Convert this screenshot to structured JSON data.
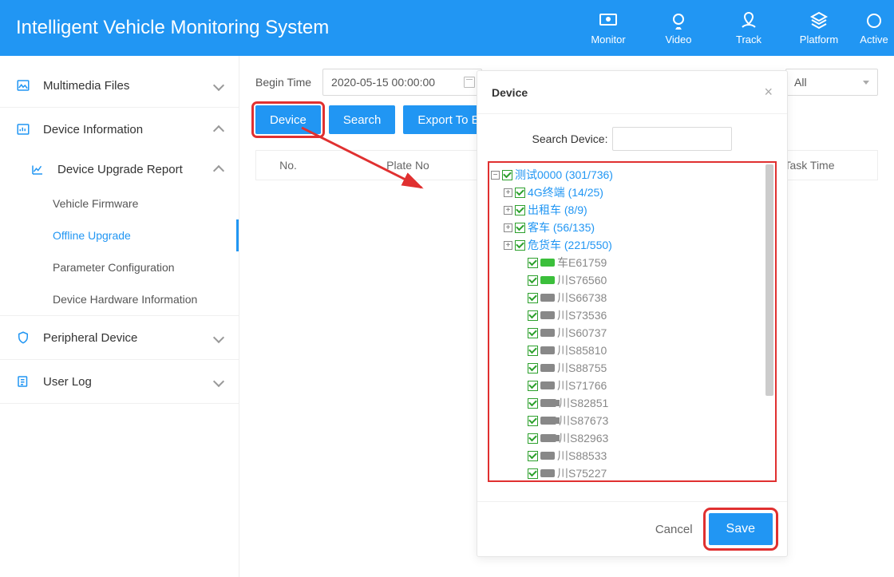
{
  "header": {
    "title": "Intelligent Vehicle Monitoring System",
    "nav": {
      "monitor": "Monitor",
      "video": "Video",
      "track": "Track",
      "platform": "Platform",
      "active": "Active"
    }
  },
  "sidebar": {
    "multimedia": "Multimedia Files",
    "device_info": "Device Information",
    "upgrade_report": "Device Upgrade Report",
    "vehicle_firmware": "Vehicle Firmware",
    "offline_upgrade": "Offline Upgrade",
    "parameter_config": "Parameter Configuration",
    "hardware_info": "Device Hardware Information",
    "peripheral": "Peripheral Device",
    "user_log": "User Log"
  },
  "toolbar": {
    "begin_time_label": "Begin Time",
    "begin_time_value": "2020-05-15 00:00:00",
    "device_btn": "Device",
    "search_btn": "Search",
    "export_btn": "Export To Excel",
    "filter_all": "All"
  },
  "table": {
    "no": "No.",
    "plate_no": "Plate No",
    "task_time": "Task Time"
  },
  "modal": {
    "title": "Device",
    "search_label": "Search Device:",
    "search_value": "",
    "cancel": "Cancel",
    "save": "Save",
    "tree": {
      "root": "测试0000 (301/736)",
      "groups": [
        {
          "label": "4G终端 (14/25)"
        },
        {
          "label": "出租车 (8/9)"
        },
        {
          "label": "客车 (56/135)"
        },
        {
          "label": "危货车 (221/550)"
        }
      ],
      "vehicles": [
        {
          "name": "车E61759",
          "status": "green",
          "type": "car"
        },
        {
          "name": "川S76560",
          "status": "green",
          "type": "car"
        },
        {
          "name": "川S66738",
          "status": "gray",
          "type": "car"
        },
        {
          "name": "川S73536",
          "status": "gray",
          "type": "car"
        },
        {
          "name": "川S60737",
          "status": "gray",
          "type": "car"
        },
        {
          "name": "川S85810",
          "status": "gray",
          "type": "car"
        },
        {
          "name": "川S88755",
          "status": "gray",
          "type": "car"
        },
        {
          "name": "川S71766",
          "status": "gray",
          "type": "car"
        },
        {
          "name": "川S82851",
          "status": "gray",
          "type": "truck"
        },
        {
          "name": "川S87673",
          "status": "gray",
          "type": "truck"
        },
        {
          "name": "川S82963",
          "status": "gray",
          "type": "truck"
        },
        {
          "name": "川S88533",
          "status": "gray",
          "type": "car"
        },
        {
          "name": "川S75227",
          "status": "gray",
          "type": "car"
        }
      ]
    }
  }
}
